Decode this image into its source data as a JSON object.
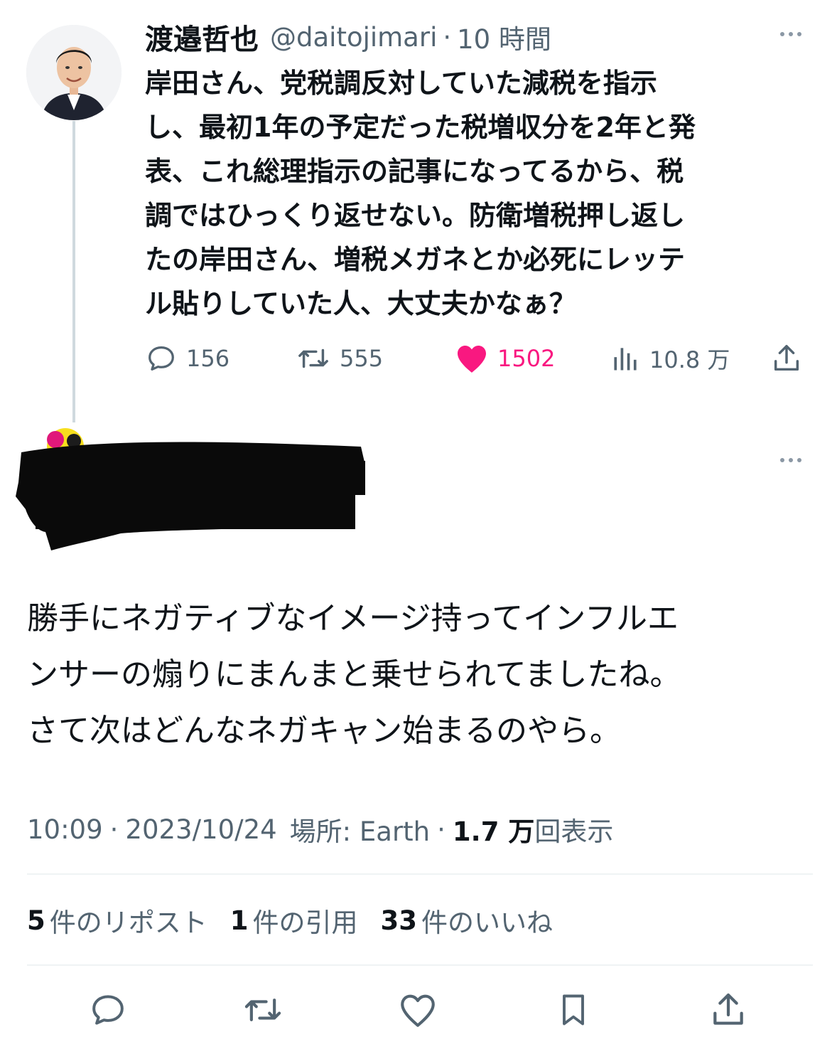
{
  "parent_tweet": {
    "display_name": "渡邉哲也",
    "handle": "@daitojimari",
    "separator": "·",
    "time": "10 時間",
    "text": "岸田さん、党税調反対していた減税を指示\nし、最初1年の予定だった税増収分を2年と発\n表、これ総理指示の記事になってるから、税\n調ではひっくり返せない。防衛増税押し返し\nたの岸田さん、増税メガネとか必死にレッテ\nル貼りしていた人、大丈夫かなぁ？",
    "actions": {
      "replies": "156",
      "reposts": "555",
      "likes": "1502",
      "views": "10.8 万"
    },
    "colors": {
      "like": "#f91880",
      "muted": "#536471"
    }
  },
  "reply": {
    "text": "勝手にネガティブなイメージ持ってインフルエ\nンサーの煽りにまんまと乗せられてましたね。\nさて次はどんなネガキャン始まるのやら。",
    "time": "10:09",
    "date": "2023/10/24",
    "location_label": "場所: Earth",
    "views_count": "1.7 万",
    "views_label": "回表示",
    "separator": "·",
    "stats": {
      "reposts_count": "5",
      "reposts_label": "件のリポスト",
      "quotes_count": "1",
      "quotes_label": "件の引用",
      "likes_count": "33",
      "likes_label": "件のいいね"
    }
  },
  "bottom_actions": [
    "reply-icon",
    "repost-icon",
    "like-icon",
    "bookmark-icon",
    "share-icon"
  ]
}
